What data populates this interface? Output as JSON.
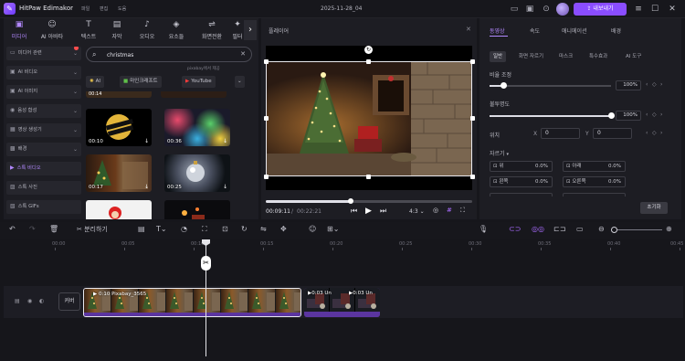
{
  "titlebar": {
    "app_name": "HitPaw Edimakor",
    "menus": [
      "파일",
      "편집",
      "도움"
    ],
    "document_title": "2025-11-28_04",
    "upgrade_label": "내보내기"
  },
  "categories": [
    {
      "label": "미디어",
      "icon": "folder-icon"
    },
    {
      "label": "AI 아바타",
      "icon": "avatar-icon"
    },
    {
      "label": "텍스트",
      "icon": "text-icon"
    },
    {
      "label": "자막",
      "icon": "caption-icon"
    },
    {
      "label": "오디오",
      "icon": "audio-icon"
    },
    {
      "label": "요소들",
      "icon": "elements-icon"
    },
    {
      "label": "화면전환",
      "icon": "transition-icon"
    },
    {
      "label": "필터",
      "icon": "filter-icon"
    }
  ],
  "sidebar": {
    "items": [
      {
        "label": "미디어 관련",
        "chevron": true
      },
      {
        "label": "AI 비디오",
        "chevron": true
      },
      {
        "label": "AI 이미지",
        "chevron": true
      },
      {
        "label": "음성 합성",
        "chevron": true
      },
      {
        "label": "영상 생성기",
        "chevron": true
      },
      {
        "label": "배경",
        "chevron": true
      },
      {
        "label": "스톡 비디오",
        "chevron": false
      },
      {
        "label": "스톡 사진",
        "chevron": false
      },
      {
        "label": "스톡 GIFs",
        "chevron": false
      }
    ]
  },
  "search": {
    "value": "christmas",
    "placeholder": ""
  },
  "provider_note": "pixabay에서 제공",
  "chips": [
    {
      "label": "AI"
    },
    {
      "label": "마인크래프트"
    },
    {
      "label": "YouTube"
    }
  ],
  "thumbnails": [
    {
      "duration": "00:14"
    },
    {
      "duration": "00:10"
    },
    {
      "duration": "00:36"
    },
    {
      "duration": "00:17"
    },
    {
      "duration": "00:25"
    }
  ],
  "player": {
    "title": "플레이어",
    "current_time": "00:09:11",
    "total_time": "00:22:21",
    "aspect": "4:3",
    "progress": 0.41
  },
  "props": {
    "tabs": [
      "동영상",
      "속도",
      "애니메이션",
      "배경"
    ],
    "sub_tabs": [
      "일반",
      "화면 자르기",
      "마스크",
      "특수효과",
      "AI 도구"
    ],
    "scale": {
      "label": "비율 조정",
      "value": "100%",
      "fraction": 0.12
    },
    "opacity": {
      "label": "불투명도",
      "value": "100%",
      "fraction": 1.0
    },
    "position": {
      "label": "위치",
      "x_label": "X",
      "x_value": "0",
      "y_label": "Y",
      "y_value": "0"
    },
    "crop": {
      "label": "자르기",
      "top_label": "위",
      "top_value": "0.0%",
      "bottom_label": "아래",
      "bottom_value": "0.0%",
      "left_label": "왼쪽",
      "left_value": "0.0%",
      "right_label": "오른쪽",
      "right_value": "0.0%"
    },
    "reset_label": "초기화"
  },
  "timeline": {
    "split_label": "분리하기",
    "ruler": [
      "00:00",
      "00:05",
      "00:10",
      "00:15",
      "00:20",
      "00:25",
      "00:30",
      "00:35",
      "00:40",
      "00:45"
    ],
    "cover_label": "커버",
    "clip1_label": "0:10 Pixabay_3565",
    "clip2_label_a": "0:03 Un",
    "clip2_label_b": "0:03 Un"
  },
  "colors": {
    "accent": "#8a4dff",
    "accent_text": "#b389ff",
    "bg": "#16161b",
    "panel": "#1d1d23"
  }
}
